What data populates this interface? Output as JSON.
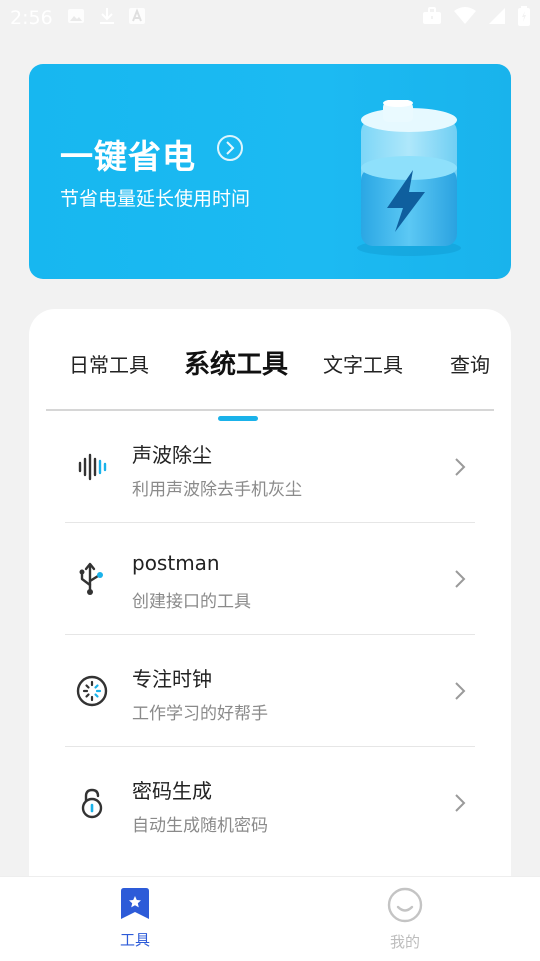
{
  "status_bar": {
    "time": "2:56",
    "left_icons": [
      "image-icon",
      "download-icon",
      "a-notification-icon"
    ],
    "right_icons": [
      "briefcase-icon",
      "wifi-icon",
      "signal-icon",
      "battery-icon"
    ]
  },
  "banner": {
    "title": "一键省电",
    "subtitle": "节省电量延长使用时间",
    "accent_color": "#1ab6ef",
    "icons": [
      "arrow-circle-icon",
      "battery-charging-icon"
    ]
  },
  "tabs": [
    {
      "label": "日常工具",
      "active": false
    },
    {
      "label": "系统工具",
      "active": true
    },
    {
      "label": "文字工具",
      "active": false
    },
    {
      "label": "查询",
      "active": false
    }
  ],
  "tools": [
    {
      "title": "声波除尘",
      "desc": "利用声波除去手机灰尘",
      "icon": "sound-wave-icon"
    },
    {
      "title": "postman",
      "desc": "创建接口的工具",
      "icon": "usb-icon"
    },
    {
      "title": "专注时钟",
      "desc": "工作学习的好帮手",
      "icon": "clock-dial-icon"
    },
    {
      "title": "密码生成",
      "desc": "自动生成随机密码",
      "icon": "lock-icon"
    }
  ],
  "bottom_nav": {
    "tools_label": "工具",
    "mine_label": "我的",
    "active_color": "#2d5bd8",
    "inactive_color": "#bdbdbd"
  }
}
